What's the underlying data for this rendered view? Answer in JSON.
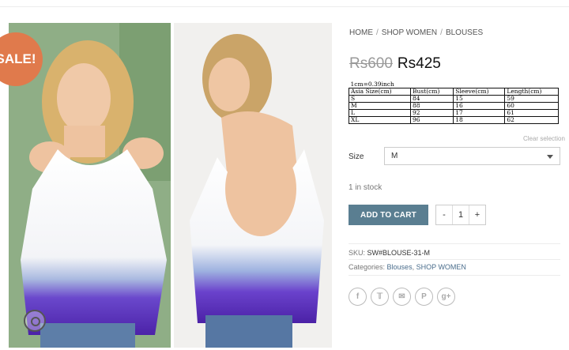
{
  "badge": {
    "sale": "SALE!"
  },
  "breadcrumb": [
    "HOME",
    "SHOP WOMEN",
    "BLOUSES"
  ],
  "price": {
    "old": "Rs600",
    "current": "Rs425"
  },
  "size_chart": {
    "caption": "1cm=0.39inch",
    "headers": [
      "Asia Size(cm)",
      "Bust(cm)",
      "Sleeve(cm)",
      "Length(cm)"
    ],
    "rows": [
      [
        "S",
        "84",
        "15",
        "59"
      ],
      [
        "M",
        "88",
        "16",
        "60"
      ],
      [
        "L",
        "92",
        "17",
        "61"
      ],
      [
        "XL",
        "96",
        "18",
        "62"
      ]
    ]
  },
  "variation": {
    "clear_label": "Clear selection",
    "size_label": "Size",
    "selected": "M"
  },
  "stock": "1 in stock",
  "cart": {
    "button_label": "ADD TO CART",
    "minus": "-",
    "quantity": "1",
    "plus": "+"
  },
  "meta": {
    "sku_label": "SKU:",
    "sku": "SW#BLOUSE-31-M",
    "categories_label": "Categories:",
    "categories": [
      "Blouses",
      "SHOP WOMEN"
    ]
  },
  "share_icons": [
    "facebook-icon",
    "twitter-icon",
    "email-icon",
    "pinterest-icon",
    "google-plus-icon"
  ],
  "colors": {
    "accent": "#5a7e91",
    "sale": "#e07a4c",
    "top_purple": "#5a2fb8"
  }
}
